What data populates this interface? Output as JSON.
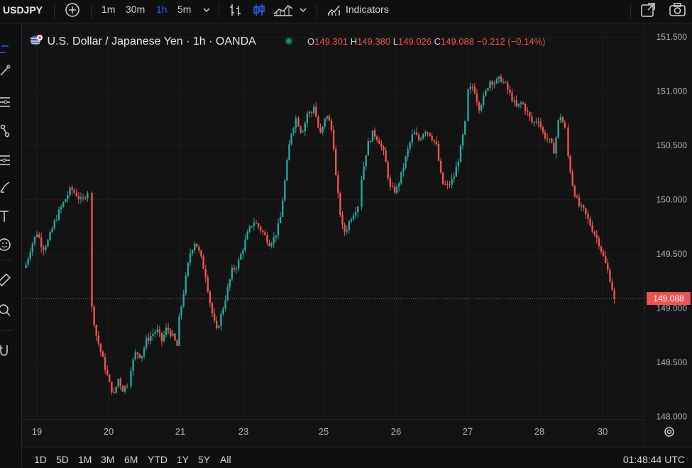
{
  "toolbar": {
    "symbol": "USDJPY",
    "intervals": [
      "1m",
      "30m",
      "1h",
      "5m"
    ],
    "active_interval": "1h",
    "indicators_label": "Indicators",
    "accent_color": "#2962ff"
  },
  "legend": {
    "title": "U.S. Dollar / Japanese Yen · 1h · OANDA",
    "o_label": "O",
    "o_value": "149.301",
    "h_label": "H",
    "h_value": "149.380",
    "l_label": "L",
    "l_value": "149.026",
    "c_label": "C",
    "c_value": "149.088",
    "change": "−0.212 (−0.14%)",
    "status_color": "#089981"
  },
  "ranges": [
    "1D",
    "5D",
    "1M",
    "3M",
    "6M",
    "YTD",
    "1Y",
    "5Y",
    "All"
  ],
  "clock": "01:48:44 UTC",
  "price_tag": "149.088",
  "colors": {
    "up": "#26a69a",
    "down": "#ef5350",
    "background": "#131313",
    "grid": "#1e1e1e"
  },
  "chart_data": {
    "type": "candlestick",
    "x_ticks": [
      "19",
      "20",
      "21",
      "23",
      "25",
      "26",
      "27",
      "28",
      "30"
    ],
    "y_ticks": [
      "151.500",
      "151.000",
      "150.500",
      "150.000",
      "149.500",
      "149.000",
      "148.500",
      "148.000"
    ],
    "ylim": [
      147.97,
      151.58
    ],
    "last_price": 149.088,
    "series": [
      {
        "day": "19",
        "close_path": [
          149.4,
          149.58,
          149.7,
          149.55,
          149.62,
          149.78,
          149.9,
          150.0,
          150.1,
          150.05,
          149.98,
          150.08
        ]
      },
      {
        "day": "19-20",
        "close_path": [
          149.0,
          148.75,
          148.6,
          148.45,
          148.3,
          148.2,
          148.35,
          148.25,
          148.3
        ]
      },
      {
        "day": "20-21",
        "close_path": [
          148.45,
          148.6,
          148.55,
          148.7,
          148.75,
          148.8,
          148.7,
          148.82,
          148.75,
          148.65
        ]
      },
      {
        "day": "21-23",
        "close_path": [
          148.9,
          149.2,
          149.5,
          149.62,
          149.48,
          149.3,
          149.0,
          148.78,
          148.95,
          149.15,
          149.35,
          149.4,
          149.55,
          149.7,
          149.8,
          149.75,
          149.68,
          149.6,
          149.65,
          149.8,
          150.2,
          150.6,
          150.75
        ]
      },
      {
        "day": "25",
        "close_path": [
          150.7,
          150.62,
          150.7,
          150.82,
          150.78,
          150.88,
          150.7,
          150.6,
          150.68,
          150.8,
          150.7,
          150.6,
          150.2,
          149.95,
          149.75,
          149.7,
          149.78,
          149.85,
          149.9,
          149.95
        ]
      },
      {
        "day": "26",
        "close_path": [
          150.2,
          150.5,
          150.62,
          150.55,
          150.4,
          150.1,
          150.08,
          150.25,
          150.45,
          150.62,
          150.55,
          150.65,
          150.6,
          150.5,
          150.15,
          150.12,
          150.2,
          150.4,
          150.7
        ]
      },
      {
        "day": "27-28",
        "close_path": [
          151.0,
          151.05,
          150.85,
          150.95,
          151.1,
          151.08,
          151.12,
          151.05,
          150.95,
          150.85,
          150.9,
          150.8,
          150.7,
          150.75,
          150.6,
          150.55,
          150.45,
          150.8,
          150.65
        ]
      },
      {
        "day": "29-30",
        "close_path": [
          150.4,
          150.1,
          149.95,
          149.9,
          149.8,
          149.7,
          149.6,
          149.45,
          149.3,
          149.09
        ]
      }
    ]
  }
}
